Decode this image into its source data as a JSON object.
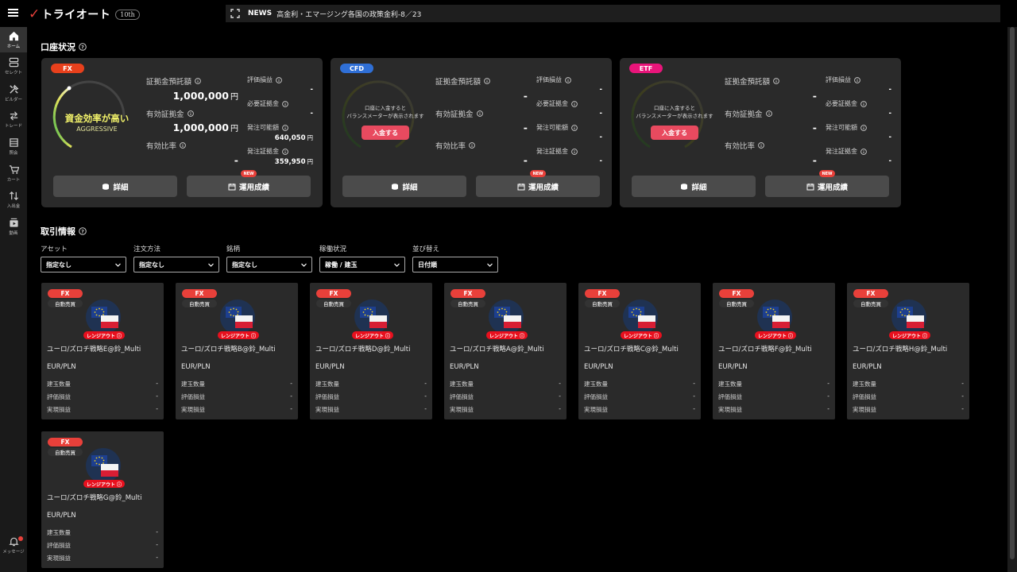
{
  "header": {
    "logo_text": "トライオート",
    "logo_badge": "10th",
    "news_label": "NEWS",
    "news_text": "高金利・エマージング各国の政策金利-8／23"
  },
  "sidebar": {
    "items": [
      {
        "label": "ホーム",
        "icon": "home-icon"
      },
      {
        "label": "セレクト",
        "icon": "select-icon"
      },
      {
        "label": "ビルダー",
        "icon": "builder-icon"
      },
      {
        "label": "トレード",
        "icon": "trade-icon"
      },
      {
        "label": "照会",
        "icon": "inquiry-icon"
      },
      {
        "label": "カート",
        "icon": "cart-icon"
      },
      {
        "label": "入出金",
        "icon": "transfer-icon"
      },
      {
        "label": "動画",
        "icon": "video-icon"
      }
    ],
    "message_label": "メッセージ"
  },
  "account_section": {
    "title": "口座状況",
    "cards": [
      {
        "asset": "FX",
        "asset_color": "#e8401c",
        "gauge_main": "資金効率が高い",
        "gauge_sub": "AGGRESSIVE",
        "gauge_level": 0.72,
        "labels": {
          "deposit": "証拠金預託額",
          "effective": "有効証拠金",
          "ratio": "有効比率",
          "valuation": "評価損益",
          "required": "必要証拠金",
          "available": "発注可能額",
          "order_margin": "発注証拠金"
        },
        "values": {
          "deposit": "1,000,000",
          "effective": "1,000,000",
          "ratio": "-",
          "valuation": "-",
          "required": "-",
          "available": "640,050",
          "order_margin": "359,950"
        },
        "yen": "円",
        "detail_label": "詳細",
        "performance_label": "運用成績",
        "new_label": "NEW"
      },
      {
        "asset": "CFD",
        "asset_color": "#2f6fd6",
        "prompt_line1": "口座に入金すると",
        "prompt_line2": "バランスメーターが表示されます",
        "deposit_button": "入金する",
        "labels": {
          "deposit": "証拠金預託額",
          "effective": "有効証拠金",
          "ratio": "有効比率",
          "valuation": "評価損益",
          "required": "必要証拠金",
          "available": "発注可能額",
          "order_margin": "発注証拠金"
        },
        "values": {
          "deposit": "-",
          "effective": "-",
          "ratio": "-",
          "valuation": "-",
          "required": "-",
          "available": "-",
          "order_margin": "-"
        },
        "detail_label": "詳細",
        "performance_label": "運用成績",
        "new_label": "NEW"
      },
      {
        "asset": "ETF",
        "asset_color": "#e8157a",
        "prompt_line1": "口座に入金すると",
        "prompt_line2": "バランスメーターが表示されます",
        "deposit_button": "入金する",
        "labels": {
          "deposit": "証拠金預託額",
          "effective": "有効証拠金",
          "ratio": "有効比率",
          "valuation": "評価損益",
          "required": "必要証拠金",
          "available": "発注可能額",
          "order_margin": "発注証拠金"
        },
        "values": {
          "deposit": "-",
          "effective": "-",
          "ratio": "-",
          "valuation": "-",
          "required": "-",
          "available": "-",
          "order_margin": "-"
        },
        "detail_label": "詳細",
        "performance_label": "運用成績",
        "new_label": "NEW"
      }
    ]
  },
  "trade_section": {
    "title": "取引情報",
    "filters": [
      {
        "label": "アセット",
        "value": "指定なし"
      },
      {
        "label": "注文方法",
        "value": "指定なし"
      },
      {
        "label": "銘柄",
        "value": "指定なし"
      },
      {
        "label": "稼働状況",
        "value": "稼働 / 建玉"
      },
      {
        "label": "並び替え",
        "value": "日付順"
      }
    ],
    "card_common": {
      "asset": "FX",
      "auto": "自動売買",
      "range_out": "レンジアウト",
      "pair": "EUR/PLN",
      "position_label": "建玉数量",
      "valuation_label": "評価損益",
      "realized_label": "実現損益"
    },
    "cards": [
      {
        "name": "ユーロ/ズロチ戦略E@鈴_Multi",
        "position": "-",
        "valuation": "-",
        "realized": "-"
      },
      {
        "name": "ユーロ/ズロチ戦略B@鈴_Multi",
        "position": "-",
        "valuation": "-",
        "realized": "-"
      },
      {
        "name": "ユーロ/ズロチ戦略D@鈴_Multi",
        "position": "-",
        "valuation": "-",
        "realized": "-"
      },
      {
        "name": "ユーロ/ズロチ戦略A@鈴_Multi",
        "position": "-",
        "valuation": "-",
        "realized": "-"
      },
      {
        "name": "ユーロ/ズロチ戦略C@鈴_Multi",
        "position": "-",
        "valuation": "-",
        "realized": "-"
      },
      {
        "name": "ユーロ/ズロチ戦略F@鈴_Multi",
        "position": "-",
        "valuation": "-",
        "realized": "-"
      },
      {
        "name": "ユーロ/ズロチ戦略H@鈴_Multi",
        "position": "-",
        "valuation": "-",
        "realized": "-"
      },
      {
        "name": "ユーロ/ズロチ戦略G@鈴_Multi",
        "position": "-",
        "valuation": "-",
        "realized": "-"
      }
    ]
  }
}
